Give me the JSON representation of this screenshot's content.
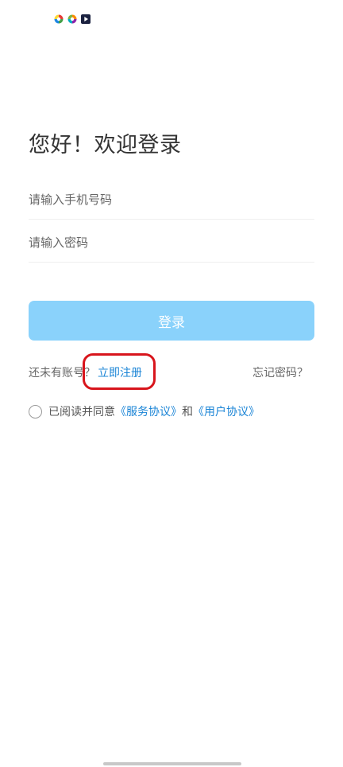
{
  "status_bar": {
    "icons": [
      "colorful-app-icon",
      "colorful-app-icon",
      "video-play-icon"
    ]
  },
  "login": {
    "title": "您好！欢迎登录",
    "phone_placeholder": "请输入手机号码",
    "password_placeholder": "请输入密码",
    "login_button": "登录",
    "no_account_text": "还未有账号？",
    "register_link": "立即注册",
    "forgot_password": "忘记密码？",
    "agreement": {
      "prefix": "已阅读并同意",
      "service_link": "《服务协议》",
      "and": "和",
      "user_link": "《用户协议》"
    }
  },
  "colors": {
    "accent": "#1a84d6",
    "button_disabled": "#8ad2fb",
    "annotation": "#d8151c"
  }
}
